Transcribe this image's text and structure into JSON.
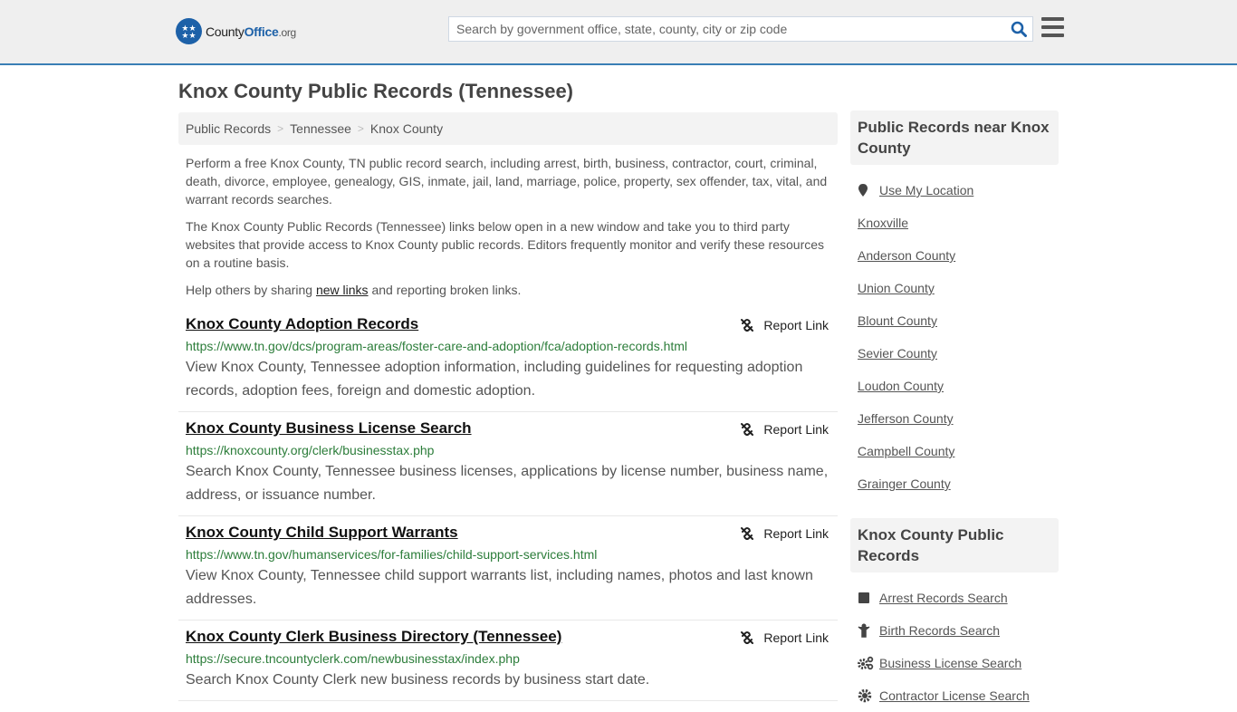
{
  "header": {
    "logo_main": "County",
    "logo_accent": "Office",
    "logo_suffix": ".org",
    "search_placeholder": "Search by government office, state, county, city or zip code"
  },
  "page_title": "Knox County Public Records (Tennessee)",
  "breadcrumb": [
    "Public Records",
    "Tennessee",
    "Knox County"
  ],
  "intro": {
    "p1": "Perform a free Knox County, TN public record search, including arrest, birth, business, contractor, court, criminal, death, divorce, employee, genealogy, GIS, inmate, jail, land, marriage, police, property, sex offender, tax, vital, and warrant records searches.",
    "p2": "The Knox County Public Records (Tennessee) links below open in a new window and take you to third party websites that provide access to Knox County public records. Editors frequently monitor and verify these resources on a routine basis.",
    "p3_before": "Help others by sharing ",
    "p3_link": "new links",
    "p3_after": " and reporting broken links."
  },
  "report_label": "Report Link",
  "records": [
    {
      "title": "Knox County Adoption Records",
      "url": "https://www.tn.gov/dcs/program-areas/foster-care-and-adoption/fca/adoption-records.html",
      "desc": "View Knox County, Tennessee adoption information, including guidelines for requesting adoption records, adoption fees, foreign and domestic adoption."
    },
    {
      "title": "Knox County Business License Search",
      "url": "https://knoxcounty.org/clerk/businesstax.php",
      "desc": "Search Knox County, Tennessee business licenses, applications by license number, business name, address, or issuance number."
    },
    {
      "title": "Knox County Child Support Warrants",
      "url": "https://www.tn.gov/humanservices/for-families/child-support-services.html",
      "desc": "View Knox County, Tennessee child support warrants list, including names, photos and last known addresses."
    },
    {
      "title": "Knox County Clerk Business Directory (Tennessee)",
      "url": "https://secure.tncountyclerk.com/newbusinesstax/index.php",
      "desc": "Search Knox County Clerk new business records by business start date."
    }
  ],
  "sidebar": {
    "nearby_title": "Public Records near Knox County",
    "use_location": "Use My Location",
    "nearby": [
      "Knoxville",
      "Anderson County",
      "Union County",
      "Blount County",
      "Sevier County",
      "Loudon County",
      "Jefferson County",
      "Campbell County",
      "Grainger County"
    ],
    "county_title": "Knox County Public Records",
    "county_links": [
      {
        "label": "Arrest Records Search",
        "icon": "square-icon"
      },
      {
        "label": "Birth Records Search",
        "icon": "child-icon"
      },
      {
        "label": "Business License Search",
        "icon": "cogs-icon"
      },
      {
        "label": "Contractor License Search",
        "icon": "cog-icon"
      }
    ]
  }
}
